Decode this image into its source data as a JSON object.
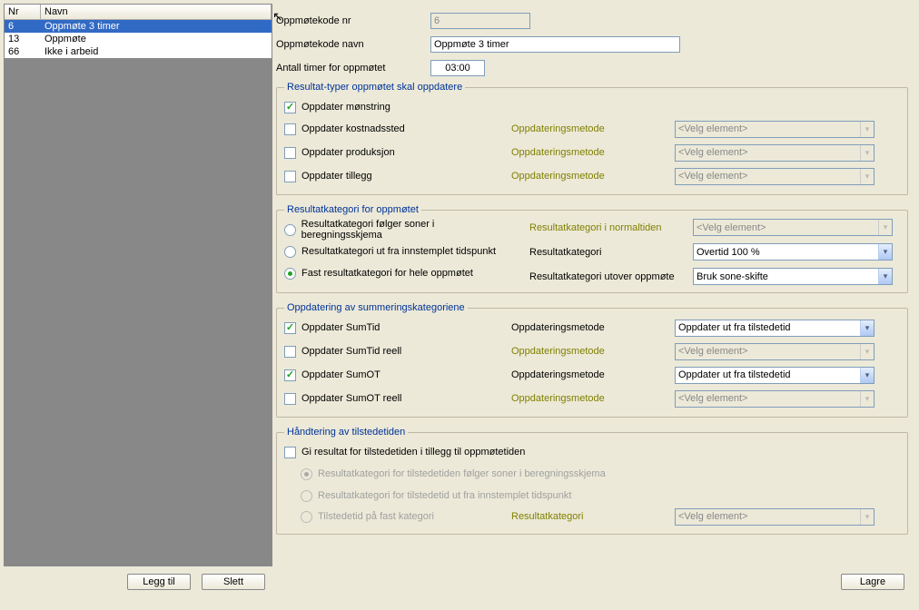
{
  "list": {
    "headers": {
      "nr": "Nr",
      "navn": "Navn"
    },
    "rows": [
      {
        "nr": "6",
        "navn": "Oppmøte 3 timer"
      },
      {
        "nr": "13",
        "navn": "Oppmøte"
      },
      {
        "nr": "66",
        "navn": "Ikke i arbeid"
      }
    ],
    "selected_index": 0
  },
  "buttons": {
    "legg_til": "Legg til",
    "slett": "Slett",
    "lagre": "Lagre"
  },
  "top": {
    "nr_label": "Oppmøtekode nr",
    "nr_value": "6",
    "navn_label": "Oppmøtekode navn",
    "navn_value": "Oppmøte 3 timer",
    "timer_label": "Antall timer for oppmøtet",
    "timer_value": "03:00"
  },
  "placeholders": {
    "velg": "<Velg element>"
  },
  "labels": {
    "oppdateringsmetode": "Oppdateringsmetode",
    "resultatkategori": "Resultatkategori",
    "resultatkategori_normal": "Resultatkategori i normaltiden",
    "resultatkategori_utover": "Resultatkategori utover oppmøte"
  },
  "group1": {
    "legend": "Resultat-typer oppmøtet skal oppdatere",
    "monstring": "Oppdater mønstring",
    "kostnadssted": "Oppdater kostnadssted",
    "produksjon": "Oppdater produksjon",
    "tillegg": "Oppdater tillegg"
  },
  "group2": {
    "legend": "Resultatkategori for oppmøtet",
    "r1": "Resultatkategori følger soner i beregningsskjema",
    "r2": "Resultatkategori ut fra innstemplet tidspunkt",
    "r3": "Fast resultatkategori for hele oppmøtet",
    "sel_kategori": "Overtid 100 %",
    "sel_utover": "Bruk sone-skifte"
  },
  "group3": {
    "legend": "Oppdatering av summeringskategoriene",
    "sumtid": "Oppdater SumTid",
    "sumtid_reell": "Oppdater SumTid reell",
    "sumot": "Oppdater SumOT",
    "sumot_reell": "Oppdater SumOT reell",
    "sel_value": "Oppdater ut fra tilstedetid"
  },
  "group4": {
    "legend": "Håndtering av tilstedetiden",
    "chk": "Gi resultat for tilstedetiden i tillegg til oppmøtetiden",
    "r1": "Resultatkategori for tilstedetiden følger soner i beregningsskjema",
    "r2": "Resultatkategori for tilstedetid ut fra innstemplet tidspunkt",
    "r3": "Tilstedetid på fast kategori"
  }
}
